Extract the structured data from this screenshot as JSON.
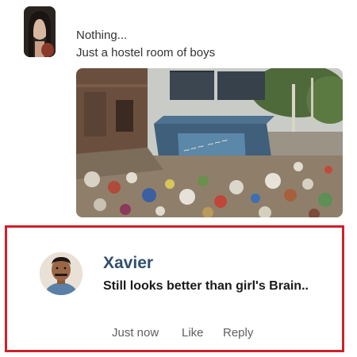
{
  "post": {
    "avatar_icon": "profile-photo-icon",
    "lines": [
      "Nothing...",
      "Just a hostel room of boys"
    ],
    "image_icon": "garbage-dumpster-photo"
  },
  "comment": {
    "avatar_icon": "profile-photo-icon",
    "author": "Xavier",
    "text": "Still looks better than girl's Brain..",
    "time": "Just now",
    "like_label": "Like",
    "reply_label": "Reply"
  },
  "colors": {
    "highlight_border": "#d0202a",
    "author_name": "#2f4f6f",
    "action_text": "#606060"
  }
}
